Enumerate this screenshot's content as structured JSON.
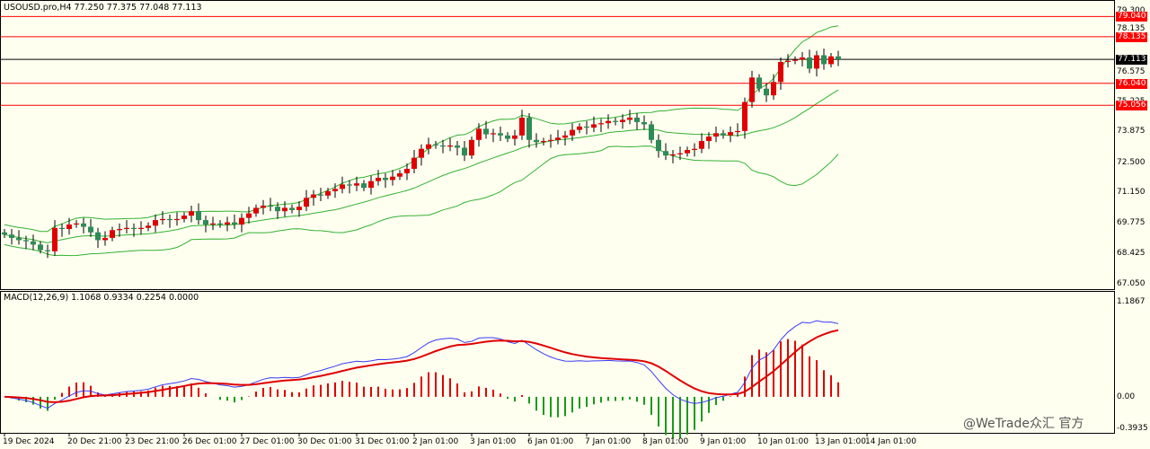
{
  "header": {
    "symbol_info": "USOUSD.pro,H4  77.250 77.375 77.048 77.113",
    "macd_info": "MACD(12,26,9) 1.1068 0.9334 0.2254 0.0000"
  },
  "price_axis": {
    "labels": [
      "79.300",
      "78.135",
      "76.575",
      "75.225",
      "73.875",
      "72.500",
      "71.150",
      "69.775",
      "68.425",
      "67.050"
    ],
    "values": [
      79.3,
      78.5,
      76.575,
      75.225,
      73.875,
      72.5,
      71.15,
      69.775,
      68.425,
      67.05
    ],
    "ylim": [
      66.8,
      79.7
    ]
  },
  "horizontal_lines": [
    {
      "label": "79.040",
      "value": 79.04,
      "color": "#ff0000"
    },
    {
      "label": "78.135",
      "value": 78.135,
      "color": "#ff0000"
    },
    {
      "label": "77.113",
      "value": 77.113,
      "color": "#000000"
    },
    {
      "label": "76.040",
      "value": 76.04,
      "color": "#ff0000"
    },
    {
      "label": "75.056",
      "value": 75.056,
      "color": "#ff0000"
    }
  ],
  "macd_axis": {
    "labels": [
      "1.1867",
      "0.00",
      "-0.3935"
    ],
    "values": [
      1.1867,
      0.0,
      -0.3935
    ],
    "ylim": [
      -0.45,
      1.3
    ]
  },
  "time_axis": {
    "labels": [
      "19 Dec 2024",
      "20 Dec 21:00",
      "23 Dec 21:00",
      "26 Dec 01:00",
      "27 Dec 01:00",
      "30 Dec 01:00",
      "31 Dec 01:00",
      "2 Jan 01:00",
      "3 Jan 01:00",
      "6 Jan 01:00",
      "7 Jan 01:00",
      "8 Jan 01:00",
      "9 Jan 01:00",
      "10 Jan 01:00",
      "13 Jan 01:00",
      "14 Jan 01:00"
    ],
    "bar_index": [
      0,
      9,
      17,
      25,
      33,
      41,
      49,
      57,
      65,
      73,
      81,
      89,
      97,
      105,
      113,
      120
    ]
  },
  "watermark": "@WeTrade众汇 官方",
  "colors": {
    "background": "#fffff0",
    "bull": "#e00000",
    "bear": "#2e8b57",
    "bands": "#32b232",
    "macd_line": "#3b3bf5",
    "signal_line": "#e00000",
    "hist_pos": "#e00000",
    "hist_neg": "#1a9a1a"
  },
  "chart_data": {
    "type": "candlestick",
    "ohlc_closes": [
      69.25,
      69.1,
      69.0,
      68.95,
      68.8,
      68.55,
      68.5,
      69.55,
      69.5,
      69.7,
      69.75,
      69.6,
      69.35,
      69.0,
      69.1,
      69.45,
      69.5,
      69.55,
      69.5,
      69.55,
      69.65,
      69.9,
      69.95,
      69.9,
      69.95,
      70.1,
      70.3,
      69.9,
      69.7,
      69.75,
      69.7,
      69.8,
      69.7,
      70.0,
      70.2,
      70.45,
      70.55,
      70.5,
      70.3,
      70.45,
      70.35,
      70.5,
      70.9,
      71.05,
      71.0,
      71.2,
      71.3,
      71.5,
      71.45,
      71.55,
      71.35,
      71.65,
      71.8,
      71.7,
      71.85,
      72.0,
      72.2,
      72.7,
      73.1,
      73.3,
      73.25,
      73.2,
      73.25,
      73.15,
      72.8,
      73.5,
      74.0,
      73.75,
      73.8,
      73.7,
      73.55,
      73.7,
      74.5,
      73.5,
      73.4,
      73.45,
      73.5,
      73.6,
      73.7,
      73.95,
      74.1,
      74.05,
      74.2,
      74.25,
      74.35,
      74.3,
      74.4,
      74.5,
      74.3,
      74.2,
      73.5,
      73.0,
      72.8,
      72.85,
      72.9,
      73.05,
      73.1,
      73.45,
      73.65,
      73.8,
      73.7,
      73.85,
      73.9,
      75.2,
      76.3,
      75.8,
      75.5,
      76.1,
      77.0,
      77.05,
      77.1,
      77.2,
      76.7,
      77.3,
      76.9,
      77.25,
      77.113
    ],
    "series": [
      {
        "name": "MACD(12,26,9)",
        "note_values": "main line"
      },
      {
        "name": "signal",
        "note_values": "signal line"
      }
    ]
  }
}
